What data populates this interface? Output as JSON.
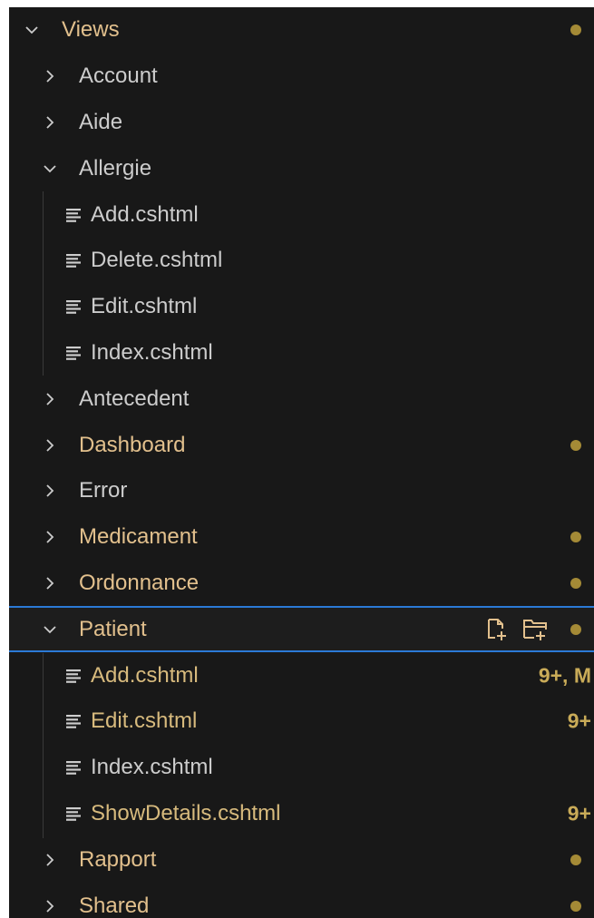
{
  "explorer": {
    "root": {
      "label": "Views",
      "modified": true
    },
    "folders": {
      "account": {
        "label": "Account"
      },
      "aide": {
        "label": "Aide"
      },
      "allergie": {
        "label": "Allergie",
        "files": [
          "Add.cshtml",
          "Delete.cshtml",
          "Edit.cshtml",
          "Index.cshtml"
        ]
      },
      "antecedent": {
        "label": "Antecedent"
      },
      "dashboard": {
        "label": "Dashboard",
        "modified": true
      },
      "error": {
        "label": "Error"
      },
      "medicament": {
        "label": "Medicament",
        "modified": true
      },
      "ordonnance": {
        "label": "Ordonnance",
        "modified": true
      },
      "patient": {
        "label": "Patient",
        "modified": true,
        "files": [
          {
            "name": "Add.cshtml",
            "badge": "9+, M"
          },
          {
            "name": "Edit.cshtml",
            "badge": "9+"
          },
          {
            "name": "Index.cshtml",
            "badge": ""
          },
          {
            "name": "ShowDetails.cshtml",
            "badge": "9+"
          }
        ]
      },
      "rapport": {
        "label": "Rapport",
        "modified": true
      },
      "shared": {
        "label": "Shared",
        "modified": true
      }
    },
    "icons": {
      "expanded": "chevron-down-icon",
      "collapsed": "chevron-right-icon",
      "file": "razor-file-icon",
      "new_file": "new-file-icon",
      "new_folder": "new-folder-icon"
    },
    "colors": {
      "background": "#181818",
      "text": "#cccccc",
      "modified": "#e2c08d",
      "dot": "#a48a36",
      "focus_border": "#2b79d6"
    }
  }
}
